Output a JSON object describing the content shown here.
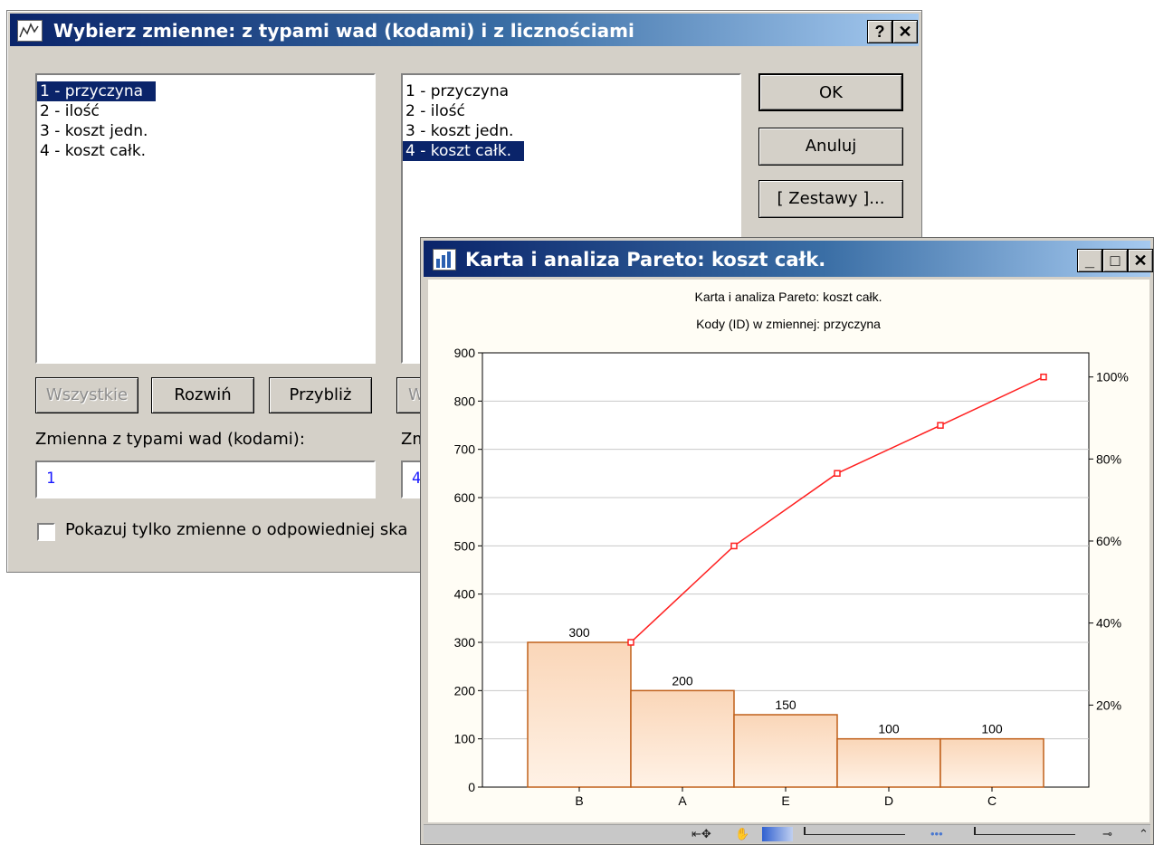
{
  "dialog": {
    "title": "Wybierz zmienne: z typami wad (kodami) i z licznościami",
    "help_label": "?",
    "close_label": "✕",
    "left_list": [
      "1 - przyczyna",
      "2 - ilość",
      "3 - koszt jedn.",
      "4 - koszt całk."
    ],
    "left_selected": 0,
    "right_list": [
      "1 - przyczyna",
      "2 - ilość",
      "3 - koszt jedn.",
      "4 - koszt całk."
    ],
    "right_selected": 3,
    "ok_label": "OK",
    "cancel_label": "Anuluj",
    "sets_label": "[ Zestawy ]...",
    "all_label": "Wszystkie",
    "expand_label": "Rozwiń",
    "zoom_label": "Przybliż",
    "right_all_partial": "W",
    "left_var_label": "Zmienna z typami wad (kodami):",
    "right_var_label_partial": "Zm",
    "left_var_value": "1",
    "right_var_value_partial": "4",
    "checkbox_label": "Pokazuj tylko zmienne o odpowiedniej ska",
    "checkbox_checked": false
  },
  "chart_window": {
    "title": "Karta i analiza Pareto: koszt całk.",
    "minimize_label": "_",
    "maximize_label": "□",
    "close_label": "✕"
  },
  "chart_data": {
    "type": "bar",
    "title": "Karta i analiza Pareto: koszt całk.",
    "subtitle": "Kody (ID) w zmiennej: przyczyna",
    "categories": [
      "B",
      "A",
      "E",
      "D",
      "C"
    ],
    "values": [
      300,
      200,
      150,
      100,
      100
    ],
    "bar_labels": [
      "300",
      "200",
      "150",
      "100",
      "100"
    ],
    "ylim": [
      0,
      900
    ],
    "y_ticks": [
      "0",
      "100",
      "200",
      "300",
      "400",
      "500",
      "600",
      "700",
      "800",
      "900"
    ],
    "y2_ticks": [
      "20%",
      "40%",
      "60%",
      "80%",
      "100%"
    ],
    "y2_tick_values": [
      20,
      40,
      60,
      80,
      100
    ],
    "cumulative_percent": [
      35.3,
      58.8,
      76.5,
      88.2,
      100.0
    ],
    "bar_color": "#fad6b8",
    "bar_border_color": "#c0601a",
    "line_color": "#ff2020",
    "grid": true
  }
}
